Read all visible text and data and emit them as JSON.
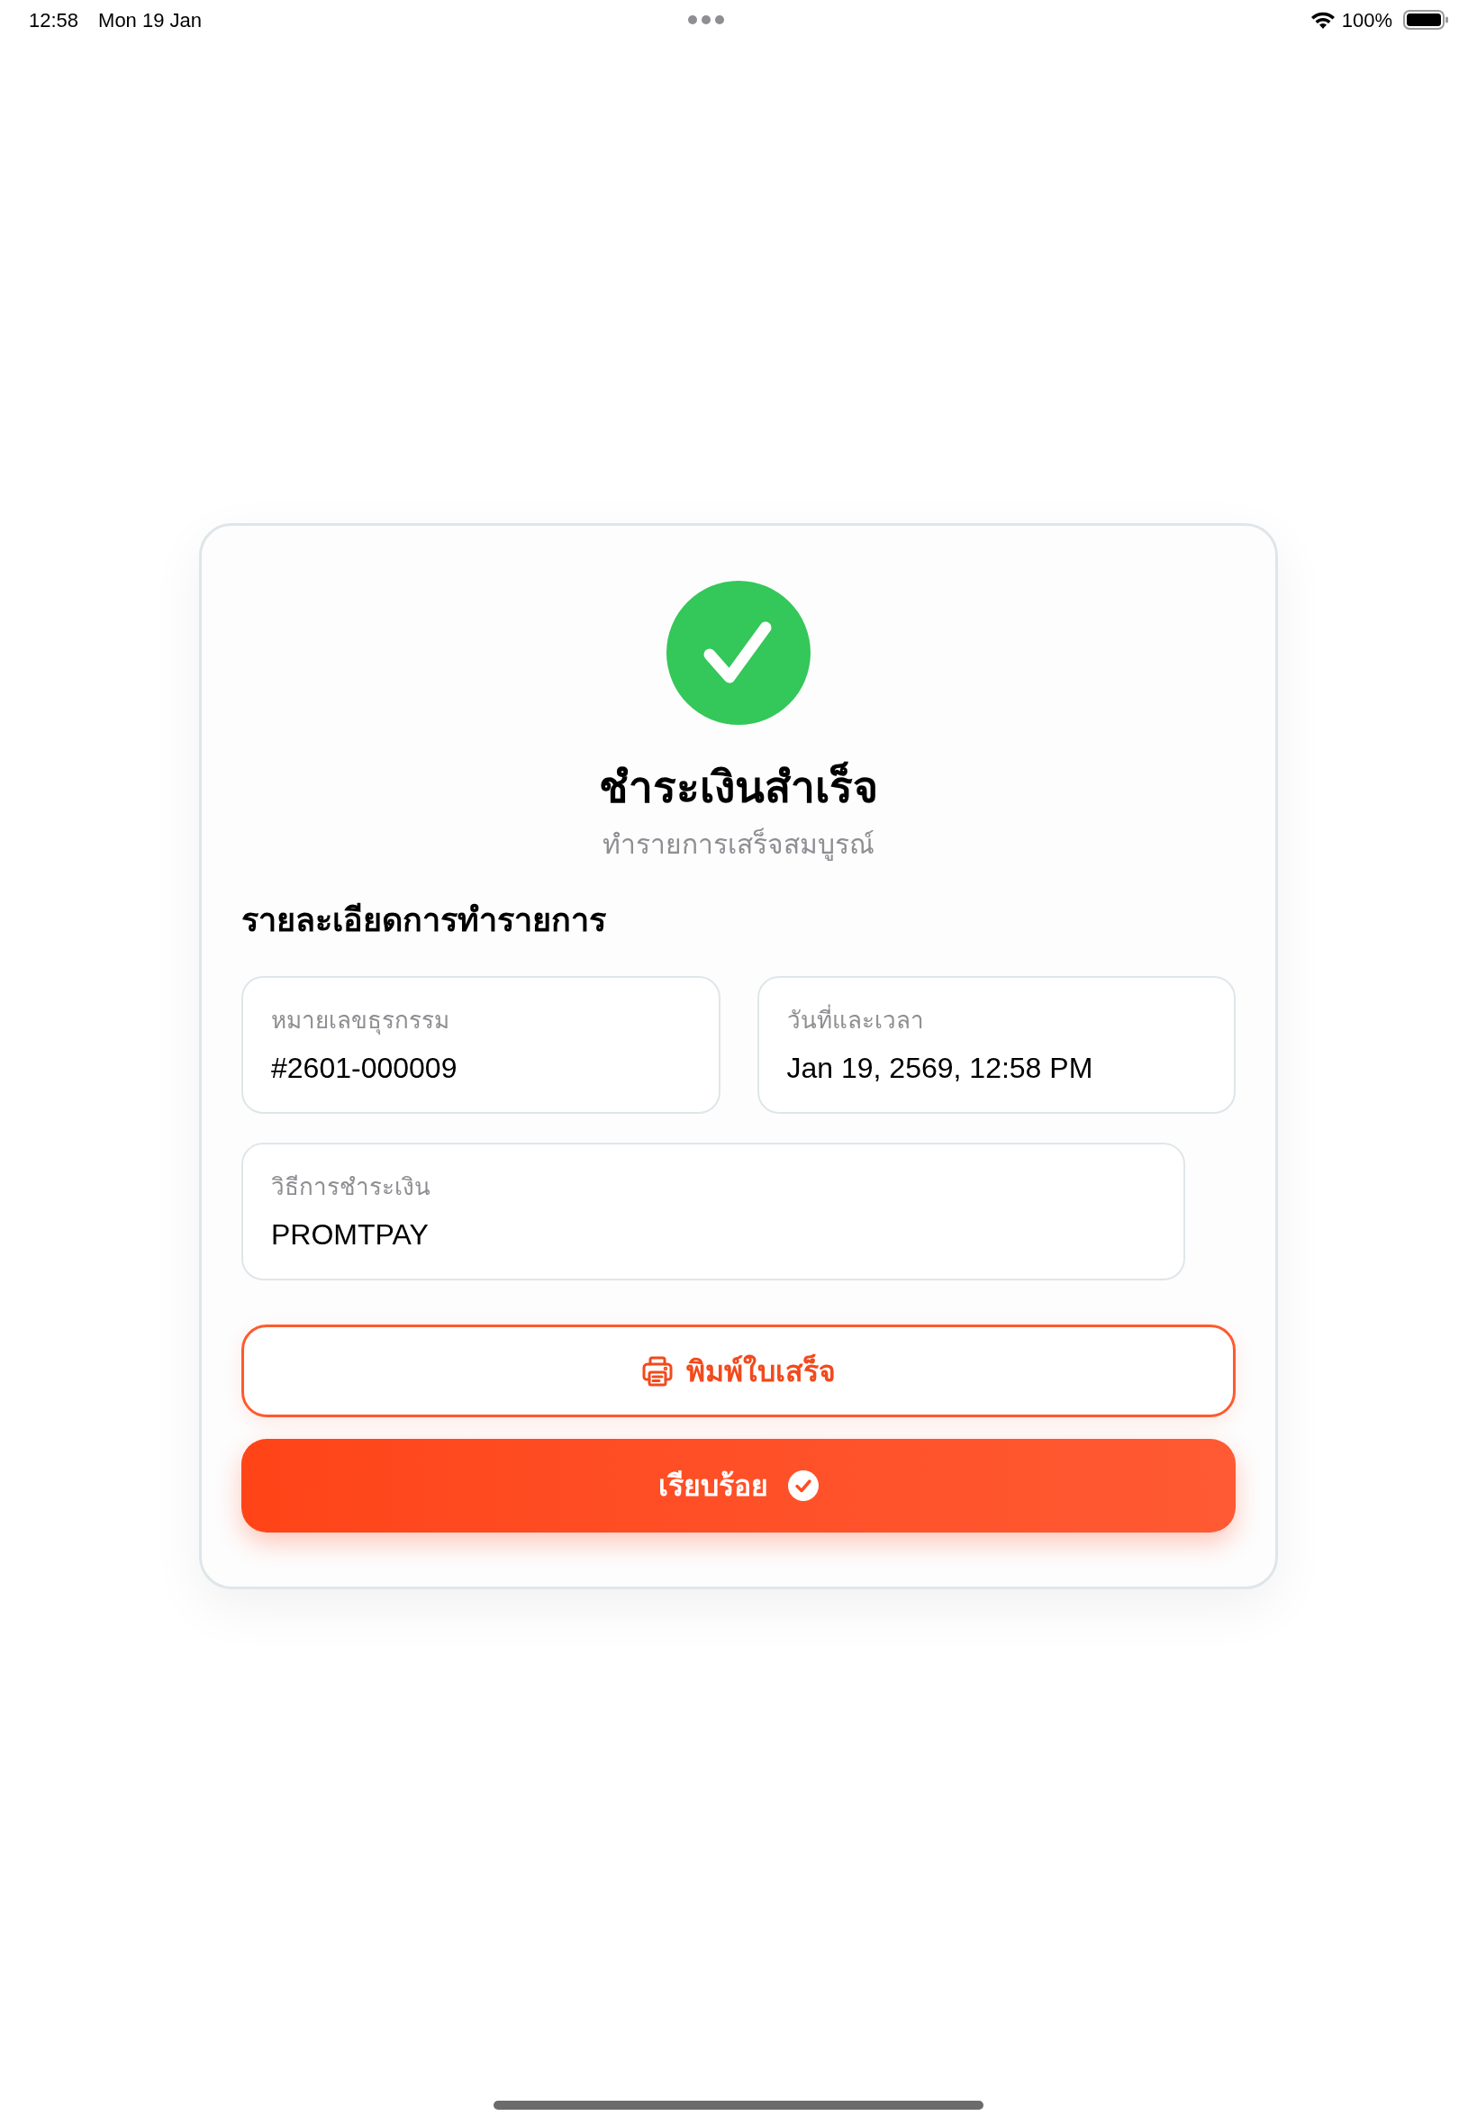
{
  "status_bar": {
    "time": "12:58",
    "date": "Mon 19 Jan",
    "battery": "100%"
  },
  "success": {
    "title": "ชำระเงินสำเร็จ",
    "subtitle": "ทำรายการเสร็จสมบูรณ์"
  },
  "details": {
    "heading": "รายละเอียดการทำรายการ",
    "fields": [
      {
        "label": "หมายเลขธุรกรรม",
        "value": "#2601-000009"
      },
      {
        "label": "วันที่และเวลา",
        "value": "Jan 19, 2569, 12:58 PM"
      },
      {
        "label": "วิธีการชำระเงิน",
        "value": "PROMTPAY"
      }
    ]
  },
  "buttons": [
    {
      "kind": "outline",
      "label": "พิมพ์ใบเสร็จ"
    },
    {
      "kind": "filled",
      "label": "เรียบร้อย"
    }
  ]
}
